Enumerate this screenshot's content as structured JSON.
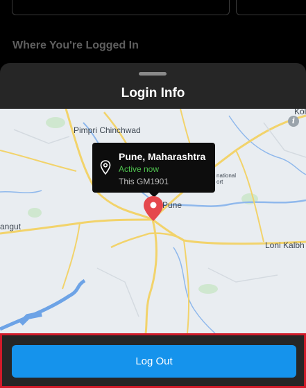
{
  "section": {
    "title": "Where You're Logged In"
  },
  "sheet": {
    "title": "Login Info"
  },
  "map": {
    "labels": {
      "pimpri": "Pimpri Chinchwad",
      "pune": "Pune",
      "loni": "Loni Kalbh",
      "angut": "angut",
      "airport_1": "national",
      "airport_2": "ort",
      "edge": "Kol"
    },
    "marker_color": "#e5484d",
    "road_color": "#f2d36b",
    "water_color": "#6da3e6"
  },
  "callout": {
    "city": "Pune, Maharashtra",
    "status": "Active now",
    "device": "This GM1901"
  },
  "actions": {
    "logout_label": "Log Out"
  },
  "colors": {
    "accent": "#1593ec",
    "highlight": "#d11b2a",
    "active": "#4fc24f"
  }
}
